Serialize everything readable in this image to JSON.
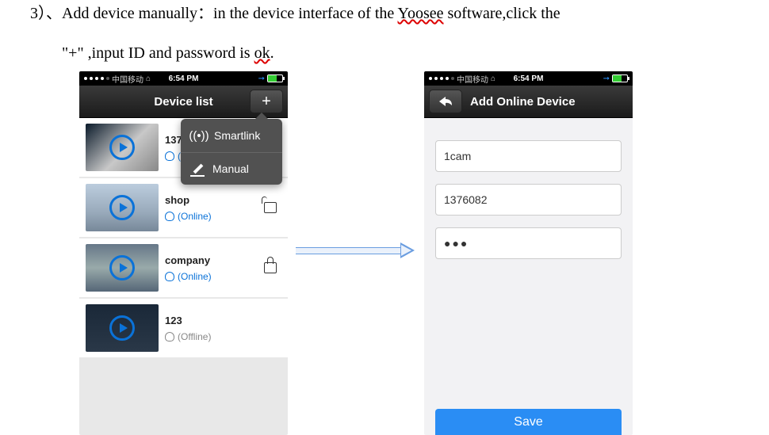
{
  "doc": {
    "line1_a": "3）、Add device manually：in the device interface of the ",
    "line1_wavy": "Yoosee",
    "line1_b": " software,click the",
    "line2_a": "\"+\" ,input ID and password is ",
    "line2_wavy": "ok",
    "line2_b": "."
  },
  "statusbar": {
    "carrier": "中国移动",
    "time": "6:54 PM"
  },
  "left_screen": {
    "title": "Device list",
    "plus_label": "+",
    "devices": [
      {
        "name": "137",
        "status_prefix": "(",
        "lock": "none"
      },
      {
        "name": "shop",
        "status": "(Online)",
        "lock": "open"
      },
      {
        "name": "company",
        "status": "(Online)",
        "lock": "closed"
      },
      {
        "name": "123",
        "status": "(Offline)",
        "lock": "none"
      }
    ],
    "popup": {
      "item1": "Smartlink",
      "item2": "Manual"
    }
  },
  "right_screen": {
    "title": "Add Online Device",
    "field_name": "1cam",
    "field_id": "1376082",
    "field_pw": "●●●",
    "save": "Save"
  }
}
